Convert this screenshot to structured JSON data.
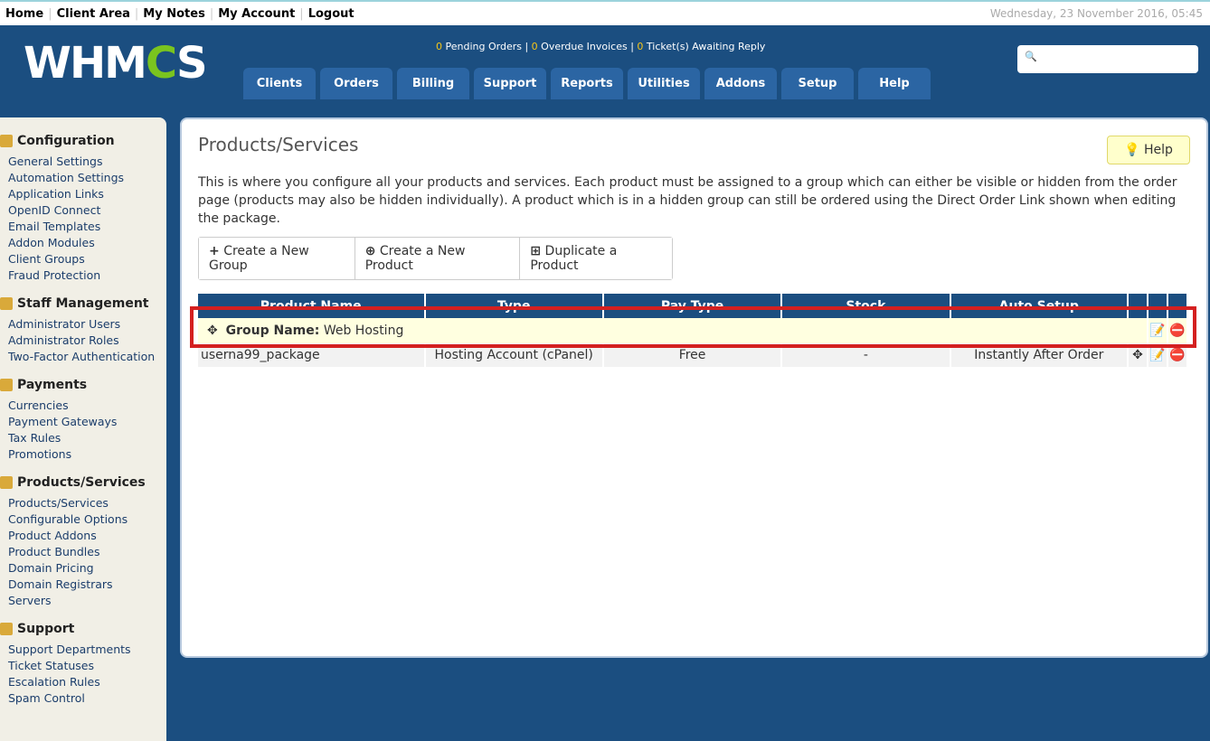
{
  "toplinks": [
    "Home",
    "Client Area",
    "My Notes",
    "My Account",
    "Logout"
  ],
  "date": "Wednesday, 23 November 2016, 05:45",
  "logo": {
    "a": "WHM",
    "b": "C",
    "c": "S"
  },
  "stats": {
    "pending": "0",
    "pending_label": "Pending Orders",
    "overdue": "0",
    "overdue_label": "Overdue Invoices",
    "tickets": "0",
    "tickets_label": "Ticket(s) Awaiting Reply"
  },
  "search_icon": "🔍",
  "tabs": [
    "Clients",
    "Orders",
    "Billing",
    "Support",
    "Reports",
    "Utilities",
    "Addons",
    "Setup",
    "Help"
  ],
  "sidebar": [
    {
      "title": "Configuration",
      "items": [
        "General Settings",
        "Automation Settings",
        "Application Links",
        "OpenID Connect",
        "Email Templates",
        "Addon Modules",
        "Client Groups",
        "Fraud Protection"
      ]
    },
    {
      "title": "Staff Management",
      "items": [
        "Administrator Users",
        "Administrator Roles",
        "Two-Factor Authentication"
      ]
    },
    {
      "title": "Payments",
      "items": [
        "Currencies",
        "Payment Gateways",
        "Tax Rules",
        "Promotions"
      ]
    },
    {
      "title": "Products/Services",
      "items": [
        "Products/Services",
        "Configurable Options",
        "Product Addons",
        "Product Bundles",
        "Domain Pricing",
        "Domain Registrars",
        "Servers"
      ]
    },
    {
      "title": "Support",
      "items": [
        "Support Departments",
        "Ticket Statuses",
        "Escalation Rules",
        "Spam Control"
      ]
    }
  ],
  "main": {
    "title": "Products/Services",
    "help": "Help",
    "description": "This is where you configure all your products and services. Each product must be assigned to a group which can either be visible or hidden from the order page (products may also be hidden individually). A product which is in a hidden group can still be ordered using the Direct Order Link shown when editing the package.",
    "buttons": [
      "Create a New Group",
      "Create a New Product",
      "Duplicate a Product"
    ],
    "columns": [
      "Product Name",
      "Type",
      "Pay Type",
      "Stock",
      "Auto Setup"
    ],
    "group_label": "Group Name:",
    "group_name": "Web Hosting",
    "row": {
      "name": "userna99_package",
      "type": "Hosting Account (cPanel)",
      "pay": "Free",
      "stock": "-",
      "setup": "Instantly After Order"
    }
  }
}
